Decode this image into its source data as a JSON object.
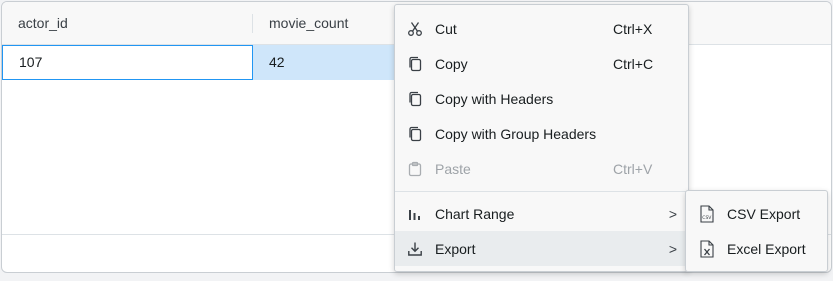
{
  "grid": {
    "columns": [
      "actor_id",
      "movie_count"
    ],
    "rows": [
      [
        "107",
        "42"
      ]
    ]
  },
  "context_menu": {
    "items": [
      {
        "label": "Cut",
        "shortcut": "Ctrl+X",
        "icon": "scissors-icon",
        "disabled": false
      },
      {
        "label": "Copy",
        "shortcut": "Ctrl+C",
        "icon": "copy-icon",
        "disabled": false
      },
      {
        "label": "Copy with Headers",
        "shortcut": "",
        "icon": "copy-icon",
        "disabled": false
      },
      {
        "label": "Copy with Group Headers",
        "shortcut": "",
        "icon": "copy-icon",
        "disabled": false
      },
      {
        "label": "Paste",
        "shortcut": "Ctrl+V",
        "icon": "clipboard-icon",
        "disabled": true
      }
    ],
    "sub_items": [
      {
        "label": "Chart Range",
        "icon": "bar-chart-icon",
        "arrow": ">"
      },
      {
        "label": "Export",
        "icon": "download-icon",
        "arrow": ">"
      }
    ]
  },
  "export_submenu": {
    "items": [
      {
        "label": "CSV Export",
        "icon": "csv-file-icon"
      },
      {
        "label": "Excel Export",
        "icon": "excel-file-icon"
      }
    ]
  }
}
